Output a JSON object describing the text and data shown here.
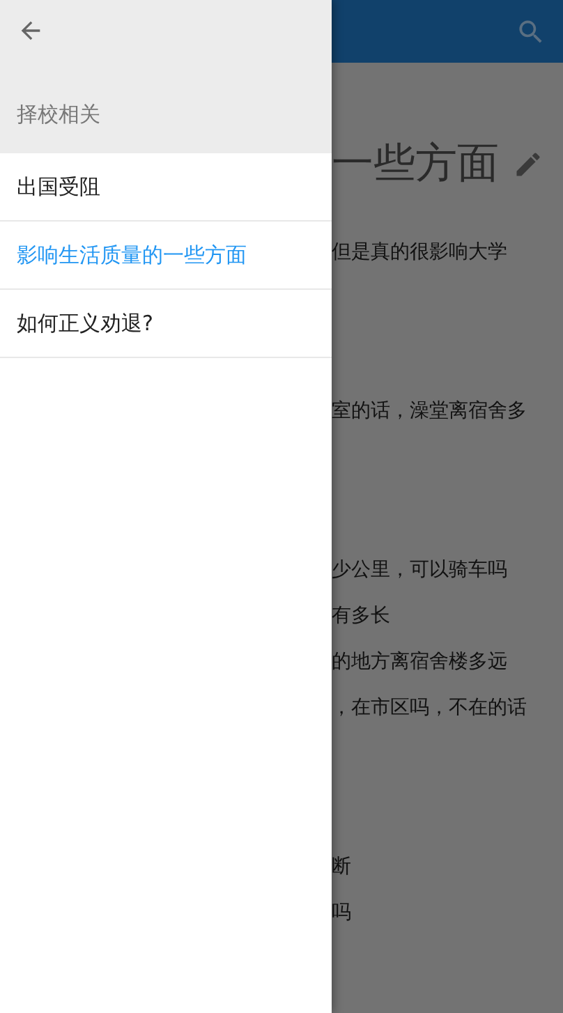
{
  "drawer": {
    "category": "择校相关",
    "items": [
      {
        "label": "出国受阻",
        "selected": false
      },
      {
        "label": "影响生活质量的一些方面",
        "selected": true
      },
      {
        "label": "如何正义劝退?",
        "selected": false
      }
    ]
  },
  "page": {
    "title": "一些方面",
    "paragraphs": [
      [
        "但是真的很影响大学"
      ],
      [
        "室的话，澡堂离宿舍多"
      ],
      [
        "少公里，可以骑车吗",
        "有多长",
        "的地方离宿舍楼多远",
        "，在市区吗，不在的话"
      ],
      [
        "断",
        "吗"
      ]
    ]
  }
}
